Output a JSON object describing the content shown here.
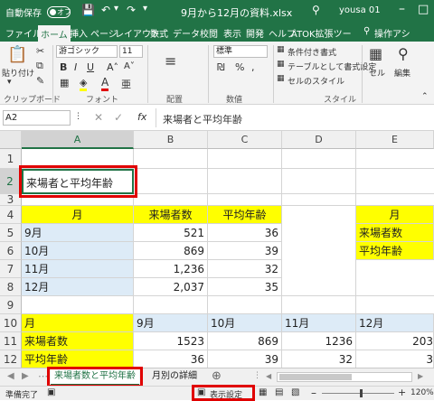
{
  "title": {
    "autosave": "自動保存",
    "autosave_state": "オフ",
    "filename": "9月から12月の資料.xlsx",
    "user": "yousa 01"
  },
  "tabs": [
    "ファイル",
    "ホーム",
    "挿入",
    "ページ",
    "レイアウト",
    "数式",
    "データ",
    "校閲",
    "表示",
    "開発",
    "ヘルプ",
    "ATOK拡張ツー"
  ],
  "ribbon": {
    "search": "操作アシ",
    "paste": "貼り付け",
    "font_name": "游ゴシック",
    "font_size": "11",
    "number_format": "標準",
    "cond_format": "条件付き書式",
    "table_format": "テーブルとして書式設定",
    "cell_style": "セルのスタイル",
    "cell": "セル",
    "edit": "編集",
    "groups": [
      "クリップボード",
      "フォント",
      "配置",
      "数値",
      "スタイル"
    ]
  },
  "formula_bar": {
    "name_box": "A2",
    "content": "来場者と平均年齢",
    "fx": "fx"
  },
  "columns": [
    "A",
    "B",
    "C",
    "D",
    "E"
  ],
  "rows": [
    "1",
    "2",
    "3",
    "4",
    "5",
    "6",
    "7",
    "8",
    "9",
    "10",
    "11",
    "12"
  ],
  "cells": {
    "A2": "来場者と平均年齢",
    "A4": "月",
    "B4": "来場者数",
    "C4": "平均年齢",
    "E4": "月",
    "A5": "9月",
    "B5": "521",
    "C5": "36",
    "E5": "来場者数",
    "A6": "10月",
    "B6": "869",
    "C6": "39",
    "E6": "平均年齢",
    "A7": "11月",
    "B7": "1,236",
    "C7": "32",
    "A8": "12月",
    "B8": "2,037",
    "C8": "35",
    "A10": "月",
    "B10": "9月",
    "C10": "10月",
    "D10": "11月",
    "E10": "12月",
    "A11": "来場者数",
    "B11": "1523",
    "C11": "869",
    "D11": "1236",
    "E11": "203",
    "A12": "平均年齢",
    "B12": "36",
    "C12": "39",
    "D12": "32",
    "E12": "3"
  },
  "sheets": [
    "来場者数と平均年齢",
    "月別の詳細"
  ],
  "status": {
    "ready": "準備完了",
    "display": "表示設定",
    "zoom": "120%"
  },
  "colors": {
    "accent": "#217346",
    "highlight": "#ffff00",
    "light_blue": "#ddebf7",
    "annotation": "#e00000"
  }
}
